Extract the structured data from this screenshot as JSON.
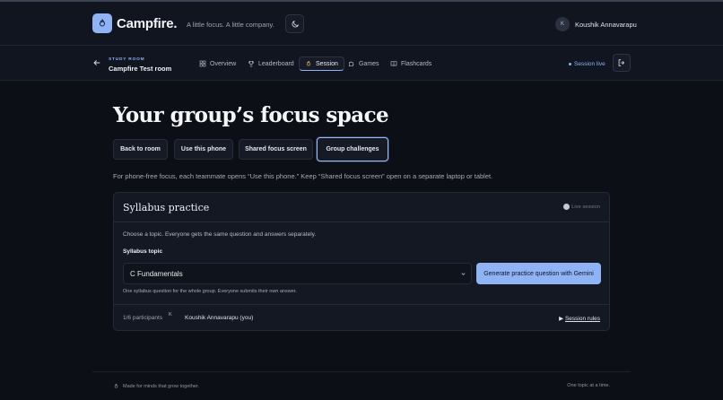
{
  "header": {
    "brand": "Campfire.",
    "tagline": "A little focus. A little company.",
    "user": {
      "initial": "K",
      "name": "Koushik Annavarapu"
    }
  },
  "room": {
    "caption": "STUDY ROOM",
    "name": "Campfire Test room",
    "tabs": [
      {
        "label": "Overview",
        "icon": "grid-icon"
      },
      {
        "label": "Leaderboard",
        "icon": "trophy-icon"
      },
      {
        "label": "Session",
        "icon": "flame-icon",
        "active": true
      },
      {
        "label": "Games",
        "icon": "puzzle-icon"
      },
      {
        "label": "Flashcards",
        "icon": "book-icon"
      }
    ],
    "status": "Session live"
  },
  "main": {
    "title": "Your group’s focus space",
    "actions": [
      "Back to room",
      "Use this phone",
      "Shared focus screen",
      "Group challenges"
    ],
    "selected_action": "Group challenges",
    "hint": "For phone-free focus, each teammate opens “Use this phone.” Keep “Shared focus screen” open on a separate laptop or tablet."
  },
  "card": {
    "title": "Syllabus practice",
    "badge": "Live session",
    "instructions": "Choose a topic. Everyone gets the same question and answers separately.",
    "field_label": "Syllabus topic",
    "topic_value": "C Fundamentals",
    "generate_label": "Generate practice question with Gemini",
    "help": "One syllabus question for the whole group. Everyone submits their own answer.",
    "participants": "1/6 participants",
    "participant_initial": "K",
    "participant_name": "Koushik Annavarapu (you)",
    "rules_label": "Session rules",
    "rules_marker": "▶"
  },
  "footer": {
    "left": "Made for minds that grow together.",
    "right": "One topic at a time."
  },
  "colors": {
    "accent": "#8fb3f5",
    "background": "#0c0f16",
    "surface": "#131823"
  }
}
